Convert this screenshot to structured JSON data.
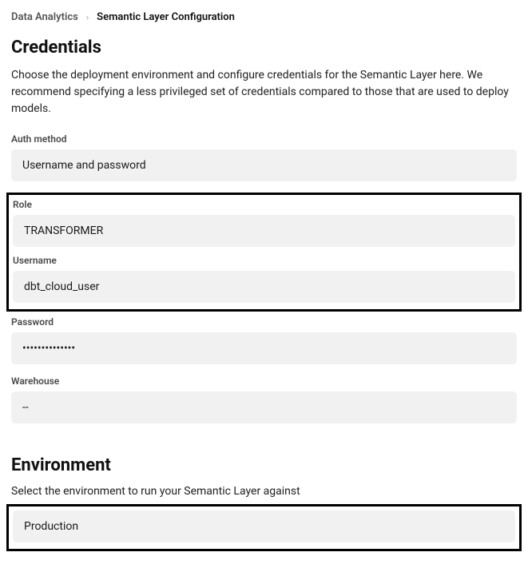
{
  "breadcrumb": {
    "parent": "Data Analytics",
    "current": "Semantic Layer Configuration"
  },
  "credentials": {
    "title": "Credentials",
    "description": "Choose the deployment environment and configure credentials for the Semantic Layer here. We recommend specifying a less privileged set of credentials compared to those that are used to deploy models.",
    "auth_method": {
      "label": "Auth method",
      "value": "Username and password"
    },
    "role": {
      "label": "Role",
      "value": "TRANSFORMER"
    },
    "username": {
      "label": "Username",
      "value": "dbt_cloud_user"
    },
    "password": {
      "label": "Password",
      "value": "••••••••••••••"
    },
    "warehouse": {
      "label": "Warehouse",
      "value": "--"
    }
  },
  "environment": {
    "title": "Environment",
    "description": "Select the environment to run your Semantic Layer against",
    "value": "Production"
  }
}
